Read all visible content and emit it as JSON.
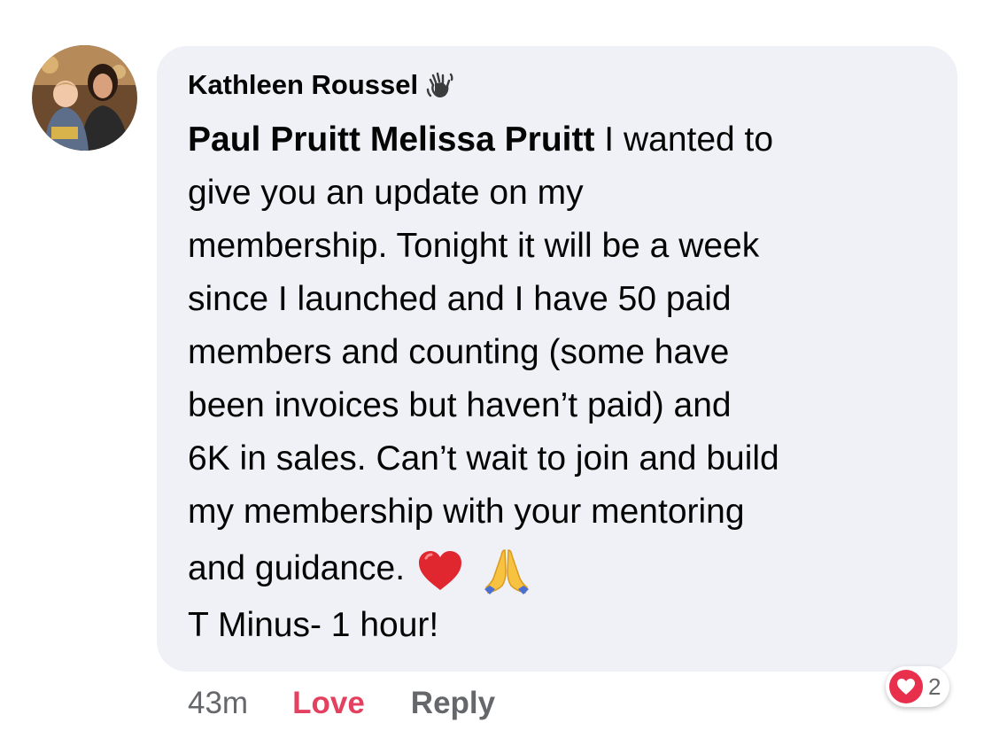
{
  "comment": {
    "author": "Kathleen Roussel",
    "author_badge_icon": "waving-hand-icon",
    "mentions": [
      "Paul Pruitt",
      "Melissa Pruitt"
    ],
    "body_lines": [
      " I wanted to",
      "give you an update on my",
      "membership. Tonight it will be a week",
      "since I launched and I have 50 paid",
      "members and counting (some have",
      "been invoices but haven’t paid) and",
      "6K in sales. Can’t wait to join and build",
      "my membership with your mentoring",
      "and guidance.",
      "T Minus- 1 hour!"
    ],
    "emojis": [
      "red-heart-emoji",
      "folded-hands-emoji"
    ]
  },
  "actions": {
    "timestamp": "43m",
    "love_label": "Love",
    "reply_label": "Reply"
  },
  "reactions": {
    "type_icon": "love-reaction-icon",
    "count": "2"
  },
  "colors": {
    "bubble_bg": "#f0f1f6",
    "love_red": "#e4405f",
    "muted_gray": "#65676b"
  }
}
